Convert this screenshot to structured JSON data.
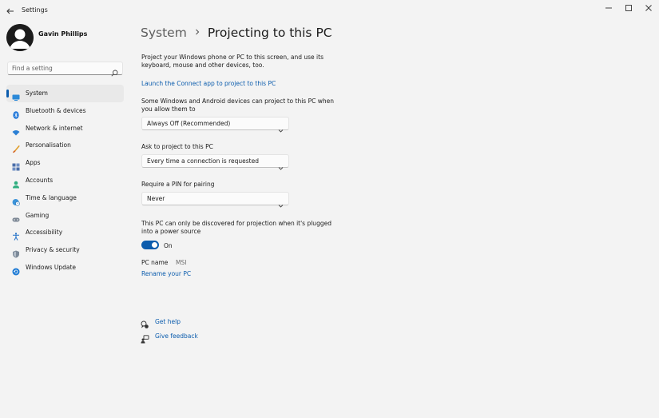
{
  "window": {
    "title": "Settings"
  },
  "profile": {
    "name": "Gavin Phillips"
  },
  "search": {
    "placeholder": "Find a setting"
  },
  "nav": {
    "items": [
      {
        "label": "System",
        "icon": "system-icon",
        "active": true
      },
      {
        "label": "Bluetooth & devices",
        "icon": "bluetooth-icon"
      },
      {
        "label": "Network & internet",
        "icon": "wifi-icon"
      },
      {
        "label": "Personalisation",
        "icon": "brush-icon"
      },
      {
        "label": "Apps",
        "icon": "apps-icon"
      },
      {
        "label": "Accounts",
        "icon": "person-icon"
      },
      {
        "label": "Time & language",
        "icon": "globe-clock-icon"
      },
      {
        "label": "Gaming",
        "icon": "gamepad-icon"
      },
      {
        "label": "Accessibility",
        "icon": "accessibility-icon"
      },
      {
        "label": "Privacy & security",
        "icon": "shield-icon"
      },
      {
        "label": "Windows Update",
        "icon": "update-icon"
      }
    ]
  },
  "breadcrumb": {
    "parent": "System",
    "current": "Projecting to this PC"
  },
  "content": {
    "intro": "Project your Windows phone or PC to this screen, and use its keyboard, mouse and other devices, too.",
    "connect_link": "Launch the Connect app to project to this PC",
    "availability": {
      "label": "Some Windows and Android devices can project to this PC when you allow them to",
      "value": "Always Off (Recommended)"
    },
    "ask": {
      "label": "Ask to project to this PC",
      "value": "Every time a connection is requested"
    },
    "pin": {
      "label": "Require a PIN for pairing",
      "value": "Never"
    },
    "power": {
      "label": "This PC can only be discovered for projection when it's plugged into a power source",
      "toggle_label": "On",
      "on": true
    },
    "pc_name": {
      "label": "PC name",
      "value": "MSI"
    },
    "rename_link": "Rename your PC",
    "help_link": "Get help",
    "feedback_link": "Give feedback"
  },
  "colors": {
    "accent": "#0b5cad",
    "background": "#f3f3f3"
  }
}
